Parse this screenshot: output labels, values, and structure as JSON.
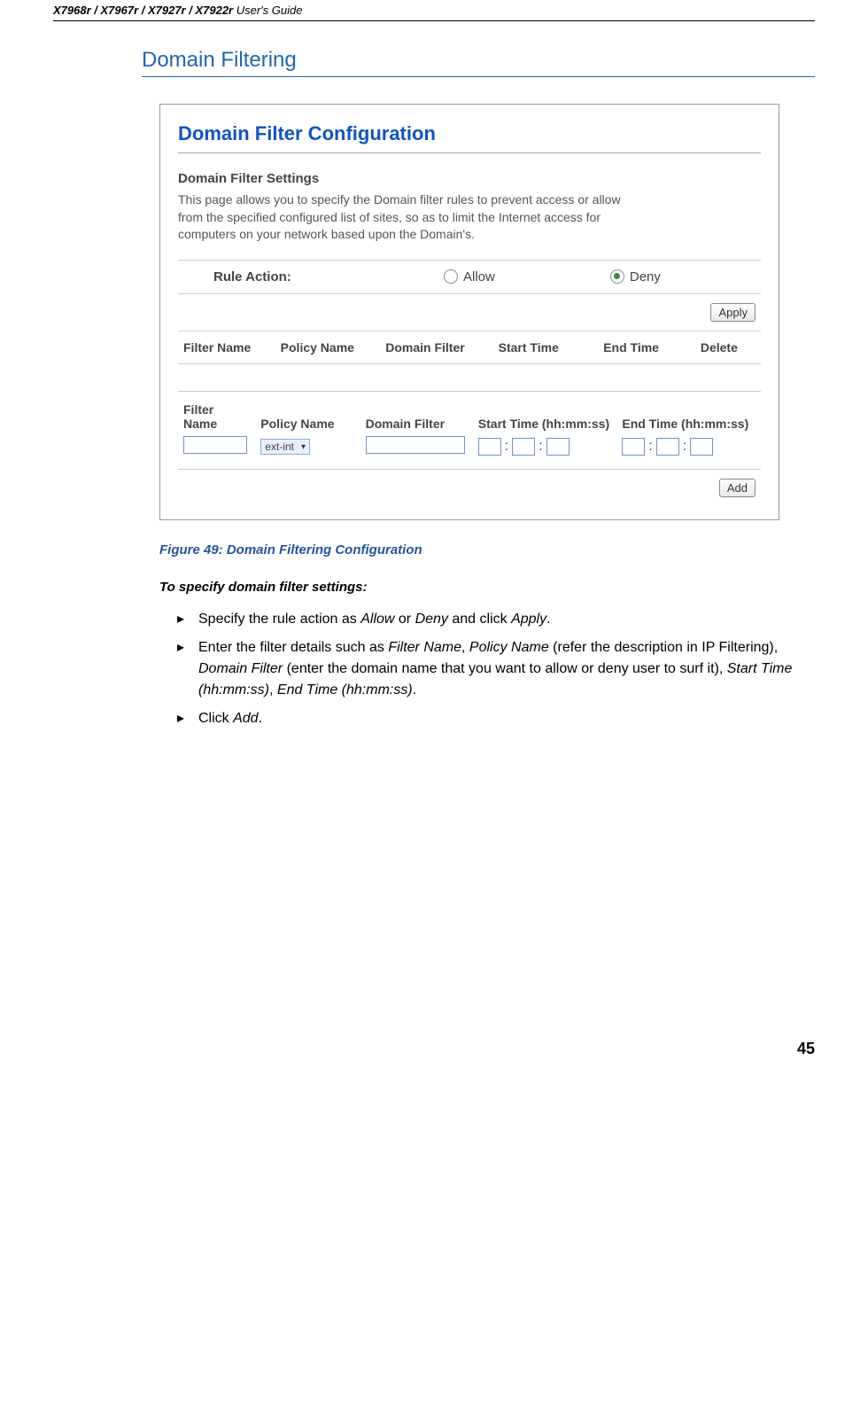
{
  "header": {
    "models": "X7968r / X7967r / X7927r / X7922r",
    "guide": " User's Guide"
  },
  "section_title": "Domain Filtering",
  "config": {
    "title": "Domain Filter Configuration",
    "settings_title": "Domain Filter Settings",
    "settings_desc": "This page allows you to specify the Domain filter rules to prevent access or allow from the specified configured list of sites, so as to limit the Internet access for computers on your network based upon the Domain's.",
    "rule_action_label": "Rule Action:",
    "radio_allow": "Allow",
    "radio_deny": "Deny",
    "apply_btn": "Apply",
    "table_headers": {
      "filter_name": "Filter Name",
      "policy_name": "Policy Name",
      "domain_filter": "Domain Filter",
      "start_time": "Start Time",
      "end_time": "End Time",
      "delete": "Delete"
    },
    "input_headers": {
      "filter_name": "Filter Name",
      "policy_name": "Policy Name",
      "domain_filter": "Domain Filter",
      "start_time": "Start Time (hh:mm:ss)",
      "end_time": "End Time (hh:mm:ss)"
    },
    "select_value": "ext-int",
    "colon": ":",
    "add_btn": "Add"
  },
  "figure_caption": "Figure 49: Domain Filtering Configuration",
  "instructions": {
    "title": "To specify domain filter settings:",
    "items": [
      {
        "pre1": "Specify the rule action as ",
        "i1": "Allow",
        "mid1": " or ",
        "i2": "Deny",
        "mid2": " and click ",
        "i3": "Apply",
        "post": "."
      },
      {
        "pre1": "Enter the filter details such as ",
        "i1": "Filter Name",
        "mid1": ", ",
        "i2": "Policy Name",
        "mid2": " (refer the description in IP Filtering), ",
        "i3": "Domain Filter",
        "mid3": " (enter the domain name that you want to allow or deny user to surf it), ",
        "i4": "Start Time (hh:mm:ss)",
        "mid4": ", ",
        "i5": "End Time (hh:mm:ss)",
        "post": "."
      },
      {
        "pre1": "Click ",
        "i1": "Add",
        "post": "."
      }
    ]
  },
  "page_number": "45"
}
